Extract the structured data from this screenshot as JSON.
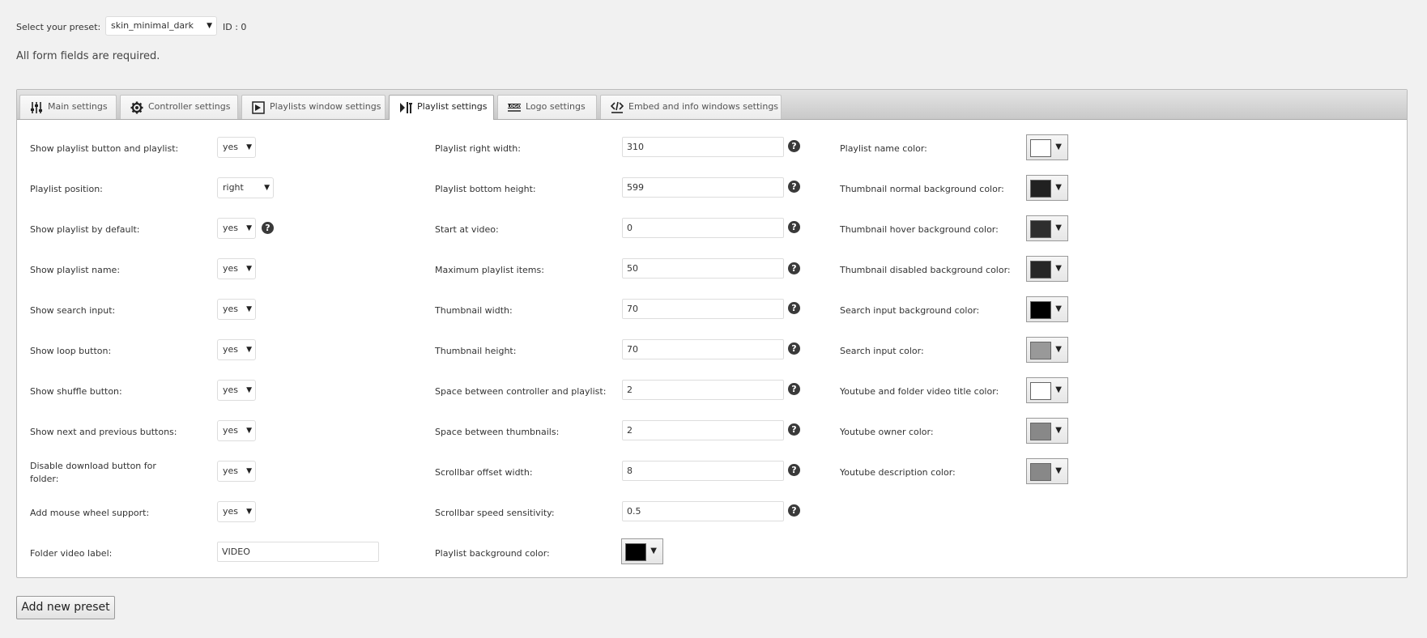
{
  "preset": {
    "label": "Select your preset:",
    "selected": "skin_minimal_dark",
    "id_text": "ID : 0"
  },
  "required_note": "All form fields are required.",
  "tabs": [
    {
      "label": "Main settings",
      "icon": "sliders-icon"
    },
    {
      "label": "Controller settings",
      "icon": "gear-icon"
    },
    {
      "label": "Playlists window settings",
      "icon": "playlists-window-icon"
    },
    {
      "label": "Playlist settings",
      "icon": "playlist-icon",
      "active": true
    },
    {
      "label": "Logo settings",
      "icon": "logo-icon"
    },
    {
      "label": "Embed and info windows settings",
      "icon": "embed-icon"
    }
  ],
  "col1": [
    {
      "label": "Show playlist button and playlist:",
      "value": "yes"
    },
    {
      "label": "Playlist position:",
      "value": "right"
    },
    {
      "label": "Show playlist by default:",
      "value": "yes"
    },
    {
      "label": "Show playlist name:",
      "value": "yes"
    },
    {
      "label": "Show search input:",
      "value": "yes"
    },
    {
      "label": "Show loop button:",
      "value": "yes"
    },
    {
      "label": "Show shuffle button:",
      "value": "yes"
    },
    {
      "label": "Show next and previous buttons:",
      "value": "yes"
    },
    {
      "label": "Disable download button for folder:",
      "value": "yes"
    },
    {
      "label": "Add mouse wheel support:",
      "value": "yes"
    },
    {
      "label": "Folder video label:",
      "value": "VIDEO"
    }
  ],
  "col2": [
    {
      "label": "Playlist right width:",
      "value": "310"
    },
    {
      "label": "Playlist bottom height:",
      "value": "599"
    },
    {
      "label": "Start at video:",
      "value": "0"
    },
    {
      "label": "Maximum playlist items:",
      "value": "50"
    },
    {
      "label": "Thumbnail width:",
      "value": "70"
    },
    {
      "label": "Thumbnail height:",
      "value": "70"
    },
    {
      "label": "Space between controller and playlist:",
      "value": "2"
    },
    {
      "label": "Space between thumbnails:",
      "value": "2"
    },
    {
      "label": "Scrollbar offset width:",
      "value": "8"
    },
    {
      "label": "Scrollbar speed sensitivity:",
      "value": "0.5"
    },
    {
      "label": "Playlist background color:",
      "color": "#000000"
    }
  ],
  "col3": [
    {
      "label": "Playlist name color:",
      "color": "#FFFFFF"
    },
    {
      "label": "Thumbnail normal background color:",
      "color": "#212121"
    },
    {
      "label": "Thumbnail hover background color:",
      "color": "#2E2E2E"
    },
    {
      "label": "Thumbnail disabled background color:",
      "color": "#272727"
    },
    {
      "label": "Search input background color:",
      "color": "#000000"
    },
    {
      "label": "Search input color:",
      "color": "#999999"
    },
    {
      "label": "Youtube and folder video title color:",
      "color": "#FFFFFF"
    },
    {
      "label": "Youtube owner color:",
      "color": "#888888"
    },
    {
      "label": "Youtube description color:",
      "color": "#888888"
    }
  ],
  "add_button_label": "Add new preset",
  "help_glyph": "?",
  "dropdown_glyph": "▼"
}
